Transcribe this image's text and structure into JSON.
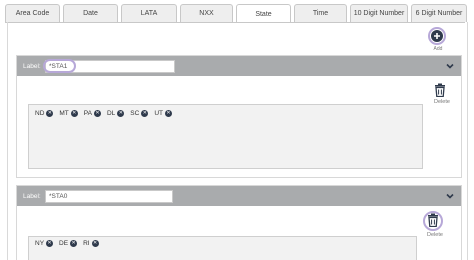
{
  "tabs": [
    {
      "label": "Area Code",
      "active": false
    },
    {
      "label": "Date",
      "active": false
    },
    {
      "label": "LATA",
      "active": false
    },
    {
      "label": "NXX",
      "active": false
    },
    {
      "label": "State",
      "active": true
    },
    {
      "label": "Time",
      "active": false
    },
    {
      "label": "10 Digit Number",
      "active": false
    },
    {
      "label": "6 Digit Number",
      "active": false
    }
  ],
  "add_button": {
    "label": "Add"
  },
  "sections": [
    {
      "label_caption": "Label:",
      "label_value": "*STA1",
      "delete_label": "Delete",
      "tags": [
        "ND",
        "MT",
        "PA",
        "DL",
        "SC",
        "UT"
      ]
    },
    {
      "label_caption": "Label:",
      "label_value": "*STA0",
      "delete_label": "Delete",
      "tags": [
        "NY",
        "DE",
        "RI"
      ]
    }
  ],
  "colors": {
    "header_bar": "#a9abad",
    "accent_ring": "#b7a8d8",
    "icon_dark": "#2f3a4c"
  }
}
